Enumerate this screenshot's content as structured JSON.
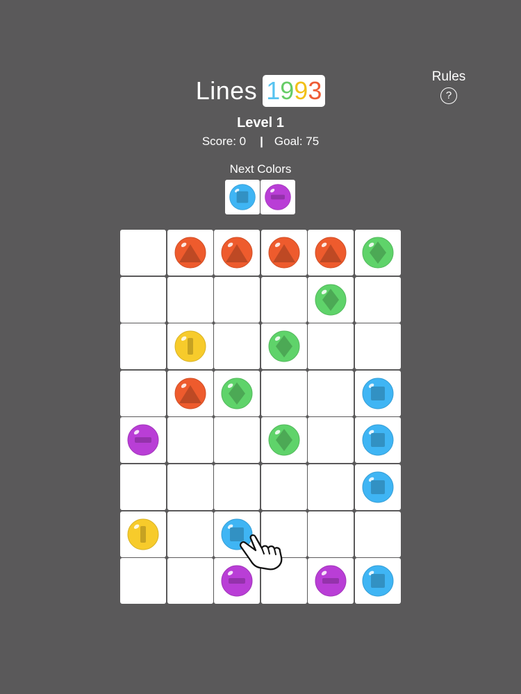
{
  "header": {
    "title_word": "Lines",
    "title_year_digits": [
      {
        "char": "1",
        "color": "#57c3f0"
      },
      {
        "char": "9",
        "color": "#66cc66"
      },
      {
        "char": "9",
        "color": "#f2c018"
      },
      {
        "char": "3",
        "color": "#ee5c35"
      }
    ],
    "rules_label": "Rules",
    "rules_icon_glyph": "?",
    "level": "Level 1",
    "score": "Score: 0",
    "separator": "|",
    "goal": "Goal: 75"
  },
  "next": {
    "label": "Next Colors",
    "colors": [
      "blue",
      "purple"
    ]
  },
  "colors": {
    "background": "#5a595a",
    "tile": "#ffffff",
    "red": "#ee5b2d",
    "green": "#5fd36a",
    "yellow": "#f7cb2b",
    "blue": "#3fb5f4",
    "purple": "#b93ed6"
  },
  "ball_symbols": {
    "red": "triangle-icon",
    "green": "diamond-icon",
    "yellow": "vertical-bar-icon",
    "blue": "square-icon",
    "purple": "horizontal-bar-icon"
  },
  "board": {
    "rows": 8,
    "cols": 6,
    "cells": [
      [
        null,
        "red",
        "red",
        "red",
        "red",
        "green"
      ],
      [
        null,
        null,
        null,
        null,
        "green",
        null
      ],
      [
        null,
        "yellow",
        null,
        "green",
        null,
        null
      ],
      [
        null,
        "red",
        "green",
        null,
        null,
        "blue"
      ],
      [
        "purple",
        null,
        null,
        "green",
        null,
        "blue"
      ],
      [
        null,
        null,
        null,
        null,
        null,
        "blue"
      ],
      [
        "yellow",
        null,
        "blue",
        null,
        null,
        null
      ],
      [
        null,
        null,
        "purple",
        null,
        "purple",
        "blue"
      ]
    ],
    "pointer_icon": "hand-pointer-icon"
  }
}
